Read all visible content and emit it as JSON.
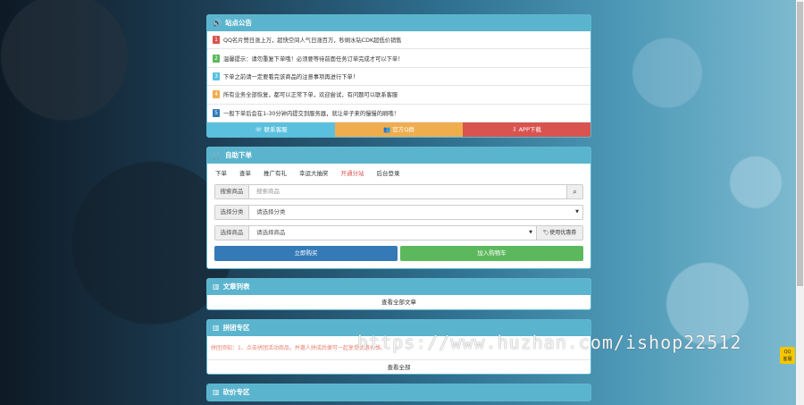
{
  "notice": {
    "title": "站点公告",
    "items": [
      {
        "num": "1",
        "color": "#d9534f",
        "text": "QQ名片赞日涨上万，超快空间人气日涨百万，秒刷水钻CDK超低价销售",
        "text_color": "#333"
      },
      {
        "num": "2",
        "color": "#5cb85c",
        "text": "温馨提示：请勿重复下单哦！必须要等待前面任务订单完成才可以下单！",
        "text_color": "#333"
      },
      {
        "num": "3",
        "color": "#5bc0de",
        "text": "下单之前请一定要看完该商品的注意事项再进行下单！",
        "text_color": "#333"
      },
      {
        "num": "4",
        "color": "#f0ad4e",
        "text": "所有业务全部恢复，都可以正常下单，欢迎尝试，有问题可以联系客服",
        "text_color": "#333"
      },
      {
        "num": "5",
        "color": "#337ab7",
        "text": "一般下单后会在1-30分钟内提交到服务器，就让单子来的慢慢的刷哦！",
        "text_color": "#333"
      }
    ],
    "buttons": [
      {
        "label": "☏ 联系客服",
        "color": "#5bc0de"
      },
      {
        "label": "👥 官方Q群",
        "color": "#f0ad4e"
      },
      {
        "label": "⇩ APP下载",
        "color": "#d9534f"
      }
    ]
  },
  "order": {
    "title": "自助下单",
    "tabs": [
      "下单",
      "查单",
      "推广有礼",
      "幸运大抽奖",
      "开通分站",
      "后台登录"
    ],
    "active_tab_color": "#d9534f",
    "search_label": "搜索商品",
    "search_placeholder": "搜索商品",
    "category_label": "选择分类",
    "category_value": "请选择分类",
    "product_label": "选择商品",
    "product_value": "请选择商品",
    "coupon_label": "使用优惠券",
    "buy_now": "立即购买",
    "add_cart": "加入购物车"
  },
  "articles": {
    "title": "文章列表",
    "view_all": "查看全部文章"
  },
  "group": {
    "title": "拼团专区",
    "notice": "拼团须知：1、点击拼团活动商品，并邀人拼成后便可一起享受优惠价格。",
    "view_all": "查看全部"
  },
  "bargain": {
    "title": "砍价专区"
  },
  "watermark": "https://www.huzhan.com/ishop22512",
  "qq_badge": "QQ\n客服"
}
